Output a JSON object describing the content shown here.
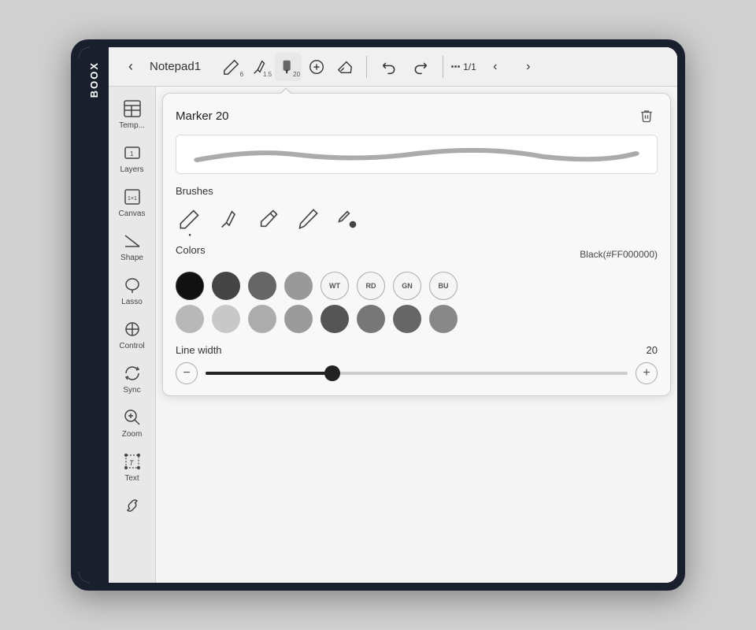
{
  "brand": "BOOX",
  "toolbar": {
    "back_label": "‹",
    "doc_title": "Notepad1",
    "tools": [
      {
        "id": "pen1",
        "label": "Pen 6",
        "badge": "6",
        "active": false
      },
      {
        "id": "pen2",
        "label": "Pen 1.5",
        "badge": "1.5",
        "active": false
      },
      {
        "id": "marker",
        "label": "Marker 20",
        "badge": "20",
        "active": true
      },
      {
        "id": "plus",
        "label": "Add",
        "badge": "",
        "active": false
      },
      {
        "id": "eraser",
        "label": "Eraser",
        "badge": "",
        "active": false
      }
    ],
    "undo_label": "↺",
    "redo_label": "↻",
    "pages_label": "1/1"
  },
  "sidebar": {
    "items": [
      {
        "id": "template",
        "label": "Temp...",
        "icon": "template-icon"
      },
      {
        "id": "layers",
        "label": "Layers",
        "icon": "layers-icon"
      },
      {
        "id": "canvas",
        "label": "Canvas",
        "icon": "canvas-icon"
      },
      {
        "id": "shape",
        "label": "Shape",
        "icon": "shape-icon"
      },
      {
        "id": "lasso",
        "label": "Lasso",
        "icon": "lasso-icon"
      },
      {
        "id": "control",
        "label": "Control",
        "icon": "control-icon"
      },
      {
        "id": "sync",
        "label": "Sync",
        "icon": "sync-icon"
      },
      {
        "id": "zoom",
        "label": "Zoom",
        "icon": "zoom-icon"
      },
      {
        "id": "text",
        "label": "Text",
        "icon": "text-icon"
      },
      {
        "id": "link",
        "label": "Link",
        "icon": "link-icon"
      }
    ]
  },
  "marker_panel": {
    "title": "Marker 20",
    "delete_label": "🗑",
    "brushes_label": "Brushes",
    "colors_label": "Colors",
    "colors_value": "Black(#FF000000)",
    "linewidth_label": "Line width",
    "linewidth_value": "20",
    "slider_percent": 30,
    "colors_row1": [
      {
        "id": "black",
        "hex": "#111111",
        "label": "",
        "type": "filled",
        "selected": true
      },
      {
        "id": "darkgray1",
        "hex": "#444444",
        "label": "",
        "type": "filled"
      },
      {
        "id": "darkgray2",
        "hex": "#666666",
        "label": "",
        "type": "filled"
      },
      {
        "id": "gray",
        "hex": "#999999",
        "label": "",
        "type": "filled"
      },
      {
        "id": "white",
        "hex": "#f5f5f5",
        "label": "WT",
        "type": "labeled"
      },
      {
        "id": "red",
        "hex": "#f5f5f5",
        "label": "RD",
        "type": "labeled"
      },
      {
        "id": "green",
        "hex": "#f5f5f5",
        "label": "GN",
        "type": "labeled"
      },
      {
        "id": "blue",
        "hex": "#f5f5f5",
        "label": "BU",
        "type": "labeled"
      }
    ],
    "colors_row2": [
      {
        "id": "lg1",
        "hex": "#b0b0b0",
        "label": "",
        "type": "filled"
      },
      {
        "id": "lg2",
        "hex": "#c0c0c0",
        "label": "",
        "type": "filled"
      },
      {
        "id": "lg3",
        "hex": "#aaaaaa",
        "label": "",
        "type": "filled"
      },
      {
        "id": "lg4",
        "hex": "#999999",
        "label": "",
        "type": "filled"
      },
      {
        "id": "dg1",
        "hex": "#555555",
        "label": "",
        "type": "filled"
      },
      {
        "id": "dg2",
        "hex": "#777777",
        "label": "",
        "type": "filled"
      },
      {
        "id": "dg3",
        "hex": "#666666",
        "label": "",
        "type": "filled"
      },
      {
        "id": "dg4",
        "hex": "#888888",
        "label": "",
        "type": "filled"
      }
    ]
  }
}
